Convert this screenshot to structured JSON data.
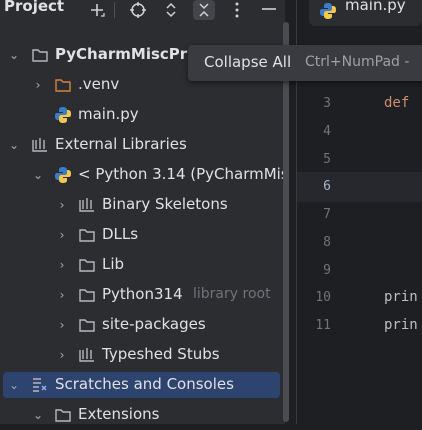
{
  "header": {
    "title": "Project",
    "icons": [
      "add-icon",
      "locate-icon",
      "expand-icon",
      "collapse-icon",
      "more-icon",
      "minimize-icon"
    ]
  },
  "tree": [
    {
      "label": "PyCharmMiscPr",
      "chevron": "down",
      "icon": "folder",
      "bold": true
    },
    {
      "label": ".venv",
      "chevron": "right",
      "icon": "folder-orange"
    },
    {
      "label": "main.py",
      "chevron": "",
      "icon": "python"
    },
    {
      "label": "External Libraries",
      "chevron": "down",
      "icon": "library"
    },
    {
      "label": "< Python 3.14 (PyCharmMis",
      "chevron": "down",
      "icon": "python"
    },
    {
      "label": "Binary Skeletons",
      "chevron": "right",
      "icon": "library"
    },
    {
      "label": "DLLs",
      "chevron": "right",
      "icon": "folder"
    },
    {
      "label": "Lib",
      "chevron": "right",
      "icon": "folder"
    },
    {
      "label": "Python314",
      "hint": "library root",
      "chevron": "right",
      "icon": "folder"
    },
    {
      "label": "site-packages",
      "chevron": "right",
      "icon": "folder"
    },
    {
      "label": "Typeshed Stubs",
      "chevron": "right",
      "icon": "library"
    },
    {
      "label": "Scratches and Consoles",
      "chevron": "down",
      "icon": "scratches",
      "selected": true
    },
    {
      "label": "Extensions",
      "chevron": "down",
      "icon": "folder"
    }
  ],
  "editor": {
    "tab_label": "main.py",
    "line_numbers": [
      "3",
      "4",
      "5",
      "6",
      "7",
      "8",
      "9",
      "10",
      "11"
    ],
    "current_line": "6",
    "code": {
      "def": "def",
      "print1": "prin",
      "print2": "prin"
    }
  },
  "tooltip": {
    "text": "Collapse All",
    "shortcut": "Ctrl+NumPad -"
  },
  "colors": {
    "panel": "#2b2d30",
    "editor": "#1e1f22",
    "selection": "#2e436e",
    "keyword": "#cf8e6d",
    "text": "#dfe1e5"
  }
}
